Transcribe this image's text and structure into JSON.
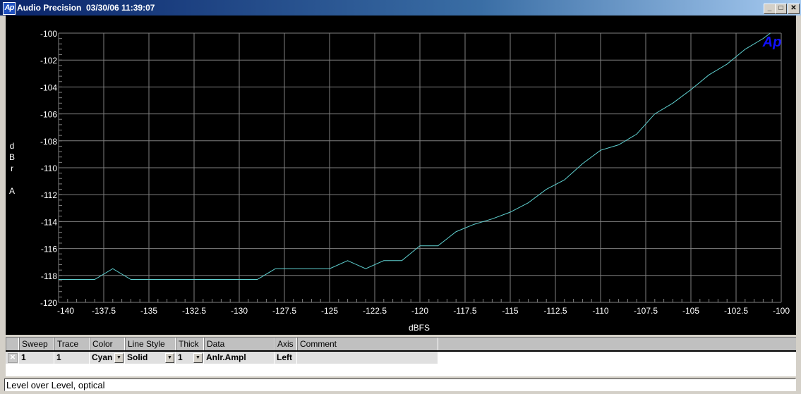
{
  "window": {
    "title": "Audio Precision",
    "datetime": "03/30/06 11:39:07",
    "logo": "Ap",
    "buttons": [
      {
        "name": "minimize",
        "glyph": "_"
      },
      {
        "name": "maximize",
        "glyph": "□"
      },
      {
        "name": "close",
        "glyph": "✕"
      }
    ]
  },
  "chart_data": {
    "type": "line",
    "xlabel": "dBFS",
    "ylabel": "dBr A",
    "ylabel_chars": [
      "d",
      "B",
      "r",
      "",
      "A"
    ],
    "xlim": [
      -140,
      -100
    ],
    "ylim": [
      -120,
      -100
    ],
    "xticks": [
      -140,
      -137.5,
      -135,
      -132.5,
      -130,
      -127.5,
      -125,
      -122.5,
      -120,
      -117.5,
      -115,
      -112.5,
      -110,
      -107.5,
      -105,
      -102.5,
      -100
    ],
    "xtick_labels": [
      "-140",
      "-137.5",
      "-135",
      "-132.5",
      "-130",
      "-127.5",
      "-125",
      "-122.5",
      "-120",
      "-117.5",
      "-115",
      "-112.5",
      "-110",
      "-107.5",
      "-105",
      "-102.5",
      "-100"
    ],
    "yticks": [
      -100,
      -102,
      -104,
      -106,
      -108,
      -110,
      -112,
      -114,
      -116,
      -118,
      -120
    ],
    "ytick_labels": [
      "-100",
      "-102",
      "-104",
      "-106",
      "-108",
      "-110",
      "-112",
      "-114",
      "-116",
      "-118",
      "-120"
    ],
    "grid": true,
    "background": "#000000",
    "grid_color": "#808080",
    "watermark": "Ap",
    "series": [
      {
        "color": "#5fd0d0",
        "x": [
          -140,
          -139,
          -138,
          -137,
          -136,
          -135,
          -134,
          -133,
          -132,
          -131,
          -130,
          -129,
          -128,
          -127,
          -126,
          -125,
          -124,
          -123,
          -122,
          -121,
          -120,
          -119,
          -118,
          -117,
          -116,
          -115,
          -114,
          -113,
          -112,
          -111,
          -110,
          -109,
          -108,
          -107,
          -106,
          -105,
          -104,
          -103,
          -102,
          -101,
          -100.6
        ],
        "y": [
          -118.3,
          -118.3,
          -118.3,
          -117.5,
          -118.3,
          -118.3,
          -118.3,
          -118.3,
          -118.3,
          -118.3,
          -118.3,
          -118.3,
          -117.5,
          -117.5,
          -117.5,
          -117.5,
          -116.9,
          -117.5,
          -116.9,
          -116.9,
          -115.8,
          -115.8,
          -114.75,
          -114.2,
          -113.8,
          -113.3,
          -112.6,
          -111.6,
          -110.9,
          -109.7,
          -108.7,
          -108.3,
          -107.5,
          -106.0,
          -105.2,
          -104.2,
          -103.1,
          -102.3,
          -101.2,
          -100.4,
          -100.0
        ]
      }
    ]
  },
  "trace_table": {
    "headers": [
      "Sweep",
      "Trace",
      "Color",
      "Line Style",
      "Thick",
      "Data",
      "Axis",
      "Comment"
    ],
    "rows": [
      {
        "checked": true,
        "sweep": "1",
        "trace": "1",
        "color": "Cyan",
        "line_style": "Solid",
        "thick": "1",
        "data": "Anlr.Ampl",
        "axis": "Left",
        "comment": ""
      }
    ]
  },
  "status": {
    "text": "Level over Level, optical"
  }
}
